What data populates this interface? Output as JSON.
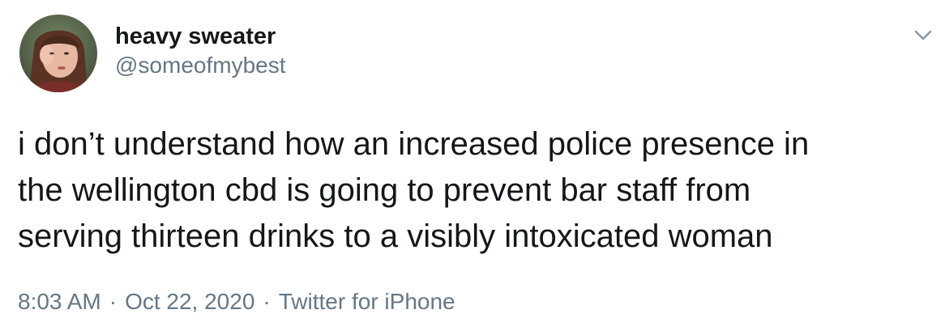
{
  "tweet": {
    "author": {
      "display_name": "heavy sweater",
      "handle": "@someofmybest",
      "avatar": "profile-photo"
    },
    "menu_icon": "chevron-down-icon",
    "text": "i don’t understand how an increased police presence in\nthe wellington cbd is going to prevent bar staff from\nserving thirteen drinks to a visibly intoxicated woman",
    "time": "8:03 AM",
    "separator": "·",
    "date": "Oct 22, 2020",
    "source": "Twitter for iPhone"
  },
  "colors": {
    "text_primary": "#14171a",
    "text_secondary": "#657786",
    "caret": "#8899a6"
  }
}
